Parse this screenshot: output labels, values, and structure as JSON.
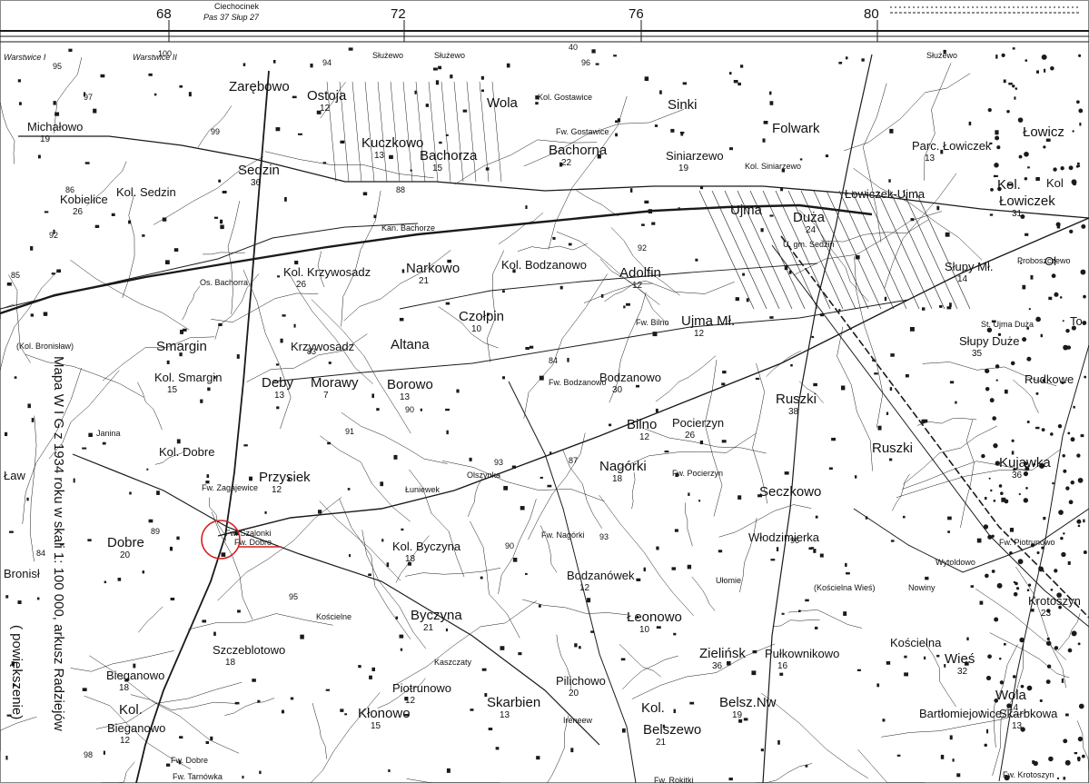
{
  "header": {
    "grid_numbers": [
      "68",
      "72",
      "76",
      "80"
    ],
    "sheet_name": "Ciechocinek",
    "sheet_ref": "Pas 37  Słup 27",
    "border_labels": [
      "Warstwice I",
      "Warstwice II",
      "Służewo",
      "Służewo",
      "Służewo",
      "40"
    ]
  },
  "side_caption": {
    "line1": "Mapa W I G z 1934 roku w skali 1: 100 000, arkusz Radziejów",
    "line2": "( powiększenie)"
  },
  "places": [
    {
      "name": "Kol. Sedzin",
      "num": ""
    },
    {
      "name": "Sedzin",
      "num": "36"
    },
    {
      "name": "Michałowo",
      "num": "19"
    },
    {
      "name": "Kobielice",
      "num": "26"
    },
    {
      "name": "Zarębowo",
      "num": ""
    },
    {
      "name": "Ostoja",
      "num": "12"
    },
    {
      "name": "Kuczkowo",
      "num": "13"
    },
    {
      "name": "Bachorza",
      "num": "15"
    },
    {
      "name": "Wola",
      "num": ""
    },
    {
      "name": "Bachorna",
      "num": "22"
    },
    {
      "name": "Sinki",
      "num": ""
    },
    {
      "name": "Folwark",
      "num": ""
    },
    {
      "name": "Siniarzewo",
      "num": "19"
    },
    {
      "name": "Parc. Łowiczek",
      "num": "13"
    },
    {
      "name": "Łowiczek-Ujma",
      "num": ""
    },
    {
      "name": "Ujma",
      "num": ""
    },
    {
      "name": "Duża",
      "num": "24"
    },
    {
      "name": "Łowiczek",
      "num": "31"
    },
    {
      "name": "Kol.",
      "num": ""
    },
    {
      "name": "Łowicz",
      "num": ""
    },
    {
      "name": "Kol. Krzywosadz",
      "num": "26"
    },
    {
      "name": "Narkowo",
      "num": "21"
    },
    {
      "name": "Kol. Bodzanowo",
      "num": ""
    },
    {
      "name": "Adolfin",
      "num": "12"
    },
    {
      "name": "Czołpin",
      "num": "10"
    },
    {
      "name": "Ujma Mł.",
      "num": "12"
    },
    {
      "name": "Słupy Mł.",
      "num": "14"
    },
    {
      "name": "Słupy Duże",
      "num": "35"
    },
    {
      "name": "Smargin",
      "num": ""
    },
    {
      "name": "Krzywosadz",
      "num": ""
    },
    {
      "name": "Altana",
      "num": ""
    },
    {
      "name": "Kol. Smargin",
      "num": "15"
    },
    {
      "name": "Deby",
      "num": "13"
    },
    {
      "name": "Morawy",
      "num": "7"
    },
    {
      "name": "Borowo",
      "num": "13"
    },
    {
      "name": "Bodzanowo",
      "num": "30"
    },
    {
      "name": "Ruszki",
      "num": "38"
    },
    {
      "name": "Bilno",
      "num": "12"
    },
    {
      "name": "Pocierzyn",
      "num": "26"
    },
    {
      "name": "Kol. Dobre",
      "num": ""
    },
    {
      "name": "Przysiek",
      "num": "12"
    },
    {
      "name": "Nagórki",
      "num": "18"
    },
    {
      "name": "Ruszki",
      "num": ""
    },
    {
      "name": "Kujawka",
      "num": "36"
    },
    {
      "name": "Seczkowo",
      "num": ""
    },
    {
      "name": "Dobre",
      "num": "20"
    },
    {
      "name": "Kol. Byczyna",
      "num": "18"
    },
    {
      "name": "Włodzimierka",
      "num": ""
    },
    {
      "name": "Bodzanówek",
      "num": "12"
    },
    {
      "name": "Byczyna",
      "num": "21"
    },
    {
      "name": "Łeonowo",
      "num": "10"
    },
    {
      "name": "Krotoszyn",
      "num": "23"
    },
    {
      "name": "Szczeblotowo",
      "num": "18"
    },
    {
      "name": "Kościelna",
      "num": ""
    },
    {
      "name": "Wieś",
      "num": "32"
    },
    {
      "name": "Zielińsk",
      "num": "36"
    },
    {
      "name": "Pułkownikowo",
      "num": "16"
    },
    {
      "name": "Bieganowo",
      "num": "18"
    },
    {
      "name": "Piotrunowo",
      "num": "12"
    },
    {
      "name": "Pilichowo",
      "num": "20"
    },
    {
      "name": "Wola",
      "num": "14"
    },
    {
      "name": "Kol.",
      "num": ""
    },
    {
      "name": "Bieganowo",
      "num": "12"
    },
    {
      "name": "Kłonowo",
      "num": "15"
    },
    {
      "name": "Skarbien",
      "num": "13"
    },
    {
      "name": "Kol.",
      "num": ""
    },
    {
      "name": "Belszewo",
      "num": "21"
    },
    {
      "name": "Belsz.Nw",
      "num": "19"
    },
    {
      "name": "Bartłomiejowice",
      "num": ""
    },
    {
      "name": "Skarbkowa",
      "num": "13"
    }
  ],
  "small_labels": [
    "Kan. Bachorze",
    "Os. Bachorra",
    "(Kol. Bronisław)",
    "Kol. Gostawice",
    "Fw. Gostawice",
    "Kol. Siniarzewo",
    "Fw. Bilno",
    "Fw. Bodzanowo",
    "Fw. Pocierzyn",
    "Fw. Nagórki",
    "Fw. Szalonki",
    "Fw. Dobre",
    "Fw. Tarnówka",
    "Fw. Rokitki",
    "Fw. Piotrunowo",
    "Fw. Krotoszyn",
    "Fw. Zagajewice",
    "U. gm. Sedzin",
    "St. Ujma Duża",
    "Proboszczewo",
    "Olszynka",
    "Łuniewek",
    "Ułomie",
    "(Kościelna Wieś)",
    "Wytoldowo",
    "Nowiny",
    "Kościelne",
    "Janina",
    "Kaszczaty",
    "Ireneew",
    "(Pilichowo)"
  ],
  "edge_labels": [
    "Ław",
    "Bronisł",
    "Ol",
    "Kol",
    "To",
    "Rudkowe"
  ],
  "spot_heights": [
    "95",
    "97",
    "99",
    "100",
    "94",
    "96",
    "92",
    "86",
    "88",
    "84",
    "85",
    "83",
    "90",
    "93",
    "91",
    "89",
    "98",
    "87",
    "84",
    "92",
    "95",
    "90",
    "93",
    "96"
  ],
  "colors": {
    "ink": "#1a1a1a",
    "paper": "#ffffff",
    "marker": "#d42020"
  },
  "marker": {
    "label": "Fw. Dobre"
  }
}
